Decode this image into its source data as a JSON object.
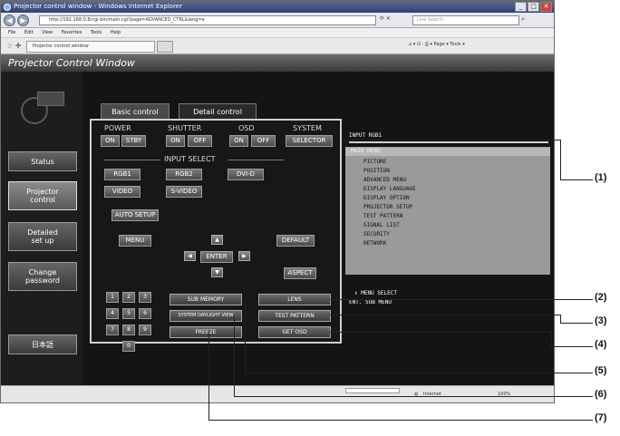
{
  "browser": {
    "title": "Projector control window - Windows Internet Explorer",
    "address": "http://192.168.0.8/cgi-bin/main.cgi?page=ADVANCED_CTRL&lang=e",
    "search_placeholder": "Live Search",
    "menu": [
      "File",
      "Edit",
      "View",
      "Favorites",
      "Tools",
      "Help"
    ],
    "tab_title": "Projector control window",
    "command_bar": "Page ▾  Tools ▾",
    "status_zone": "Internet",
    "zoom": "100%"
  },
  "app": {
    "title": "Projector Control Window",
    "sidebar": {
      "status": "Status",
      "projector_control_1": "Projector",
      "projector_control_2": "control",
      "detailed_setup_1": "Detailed",
      "detailed_setup_2": "set up",
      "change_password_1": "Change",
      "change_password_2": "password",
      "language": "日本語"
    },
    "tabs": {
      "basic": "Basic control",
      "detail": "Detail control"
    }
  },
  "controls": {
    "power": {
      "label": "POWER",
      "on": "ON",
      "standby": "STBY"
    },
    "shutter": {
      "label": "SHUTTER",
      "on": "ON",
      "off": "OFF"
    },
    "osd": {
      "label": "OSD",
      "on": "ON",
      "off": "OFF"
    },
    "system": {
      "label": "SYSTEM",
      "selector": "SELECTOR"
    },
    "input_select": {
      "label": "INPUT SELECT",
      "rgb1": "RGB1",
      "rgb2": "RGB2",
      "dvid": "DVI-D",
      "video": "VIDEO",
      "svideo": "S-VIDEO"
    },
    "auto_setup": "AUTO SETUP",
    "menu": "MENU",
    "enter": "ENTER",
    "default": "DEFAULT",
    "aspect": "ASPECT",
    "numbers": [
      "1",
      "2",
      "3",
      "4",
      "5",
      "6",
      "7",
      "8",
      "9",
      "0"
    ],
    "sub_memory": "SUB MEMORY",
    "system_daylight": "SYSTEM DAYLIGHT VIEW",
    "freeze": "FREEZE",
    "lens": "LENS",
    "test_pattern": "TEST PATTERN",
    "get_osd": "GET OSD"
  },
  "osd_display": {
    "title": "INPUT RGB1",
    "items": [
      "MAIN MENU",
      "PICTURE",
      "POSITION",
      "ADVANCED MENU",
      "DISPLAY LANGUAGE",
      "DISPLAY OPTION",
      "PROJECTOR SETUP",
      "TEST PATTERN",
      "SIGNAL LIST",
      "SECURITY",
      "NETWORK"
    ],
    "footer_1": "↕    MENU SELECT",
    "footer_2": "ENT.  SUB MENU"
  },
  "callouts": [
    "(1)",
    "(2)",
    "(3)",
    "(4)",
    "(5)",
    "(6)",
    "(7)"
  ],
  "colors": {
    "page_bg": "#141414",
    "button": "#5c5c5c",
    "osd_list": "#9a9a9a"
  }
}
